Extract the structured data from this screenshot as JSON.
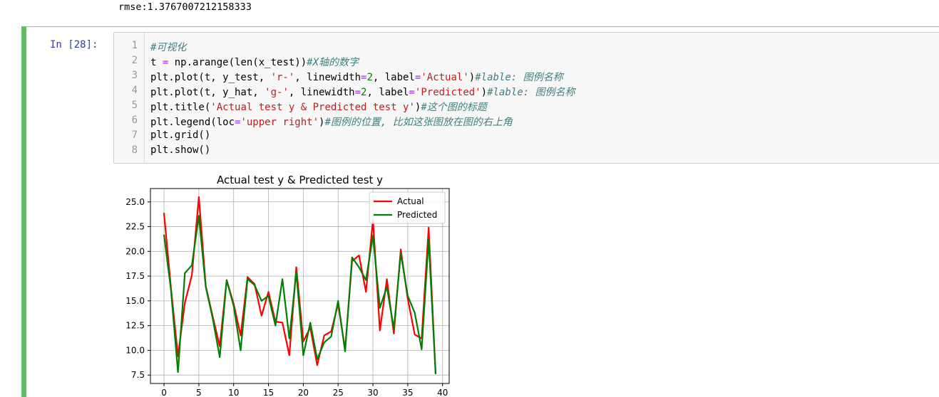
{
  "output": {
    "rmse_text": "rmse:1.3767007212158333"
  },
  "cell": {
    "prompt": "In  [28]:",
    "lines": [
      {
        "num": "1",
        "parts": [
          {
            "t": "#可视化",
            "c": "cm"
          }
        ]
      },
      {
        "num": "2",
        "parts": [
          {
            "t": "t ",
            "c": ""
          },
          {
            "t": "=",
            "c": "op"
          },
          {
            "t": " np.arange(len(x_test))",
            "c": ""
          },
          {
            "t": "#X轴的数字",
            "c": "cm"
          }
        ]
      },
      {
        "num": "3",
        "parts": [
          {
            "t": "plt.plot(t, y_test, ",
            "c": ""
          },
          {
            "t": "'r-'",
            "c": "st"
          },
          {
            "t": ", linewidth",
            "c": ""
          },
          {
            "t": "=",
            "c": "op"
          },
          {
            "t": "2",
            "c": "nu"
          },
          {
            "t": ", label",
            "c": ""
          },
          {
            "t": "=",
            "c": "op"
          },
          {
            "t": "'Actual'",
            "c": "st"
          },
          {
            "t": ")",
            "c": ""
          },
          {
            "t": "#lable: 图例名称",
            "c": "cm"
          }
        ]
      },
      {
        "num": "4",
        "parts": [
          {
            "t": "plt.plot(t, y_hat, ",
            "c": ""
          },
          {
            "t": "'g-'",
            "c": "st"
          },
          {
            "t": ", linewidth",
            "c": ""
          },
          {
            "t": "=",
            "c": "op"
          },
          {
            "t": "2",
            "c": "nu"
          },
          {
            "t": ", label",
            "c": ""
          },
          {
            "t": "=",
            "c": "op"
          },
          {
            "t": "'Predicted'",
            "c": "st"
          },
          {
            "t": ")",
            "c": ""
          },
          {
            "t": "#lable: 图例名称",
            "c": "cm"
          }
        ]
      },
      {
        "num": "5",
        "parts": [
          {
            "t": "plt.title(",
            "c": ""
          },
          {
            "t": "'Actual test y & Predicted test y'",
            "c": "st"
          },
          {
            "t": ")",
            "c": ""
          },
          {
            "t": "#这个图的标题",
            "c": "cm"
          }
        ]
      },
      {
        "num": "6",
        "parts": [
          {
            "t": "plt.legend(loc",
            "c": ""
          },
          {
            "t": "=",
            "c": "op"
          },
          {
            "t": "'upper right'",
            "c": "st"
          },
          {
            "t": ")",
            "c": ""
          },
          {
            "t": "#图例的位置, 比如这张图放在图的右上角",
            "c": "cm"
          }
        ]
      },
      {
        "num": "7",
        "parts": [
          {
            "t": "plt.grid()",
            "c": ""
          }
        ]
      },
      {
        "num": "8",
        "parts": [
          {
            "t": "plt.show()",
            "c": ""
          }
        ]
      }
    ]
  },
  "colors": {
    "actual": "#ff0000",
    "predicted": "#008000",
    "cell_bar": "#66bb6a",
    "prompt": "#303f9f"
  },
  "chart_data": {
    "type": "line",
    "title": "Actual test y & Predicted test y",
    "xlabel": "",
    "ylabel": "",
    "xlim": [
      -1.95,
      40.95
    ],
    "ylim": [
      6.65,
      26.35
    ],
    "xticks": [
      0,
      5,
      10,
      15,
      20,
      25,
      30,
      35,
      40
    ],
    "yticks": [
      7.5,
      10.0,
      12.5,
      15.0,
      17.5,
      20.0,
      22.5,
      25.0
    ],
    "xtick_labels": [
      "0",
      "5",
      "10",
      "15",
      "20",
      "25",
      "30",
      "35",
      "40"
    ],
    "ytick_labels": [
      "7.5",
      "10.0",
      "12.5",
      "15.0",
      "17.5",
      "20.0",
      "22.5",
      "25.0"
    ],
    "grid": true,
    "legend_position": "upper right",
    "x": [
      0,
      1,
      2,
      3,
      4,
      5,
      6,
      7,
      8,
      9,
      10,
      11,
      12,
      13,
      14,
      15,
      16,
      17,
      18,
      19,
      20,
      21,
      22,
      23,
      24,
      25,
      26,
      27,
      28,
      29,
      30,
      31,
      32,
      33,
      34,
      35,
      36,
      37,
      38,
      39
    ],
    "series": [
      {
        "name": "Actual",
        "color": "#ff0000",
        "values": [
          23.9,
          16.3,
          9.4,
          14.8,
          17.6,
          25.5,
          16.5,
          13.4,
          10.4,
          17.1,
          14.7,
          11.5,
          17.4,
          16.7,
          13.5,
          15.9,
          12.9,
          12.8,
          9.5,
          18.4,
          10.9,
          12.3,
          8.5,
          11.5,
          11.9,
          14.7,
          10.1,
          19.0,
          19.6,
          15.9,
          23.2,
          12.0,
          17.2,
          11.7,
          20.2,
          15.2,
          11.6,
          11.2,
          22.4,
          7.6
        ]
      },
      {
        "name": "Predicted",
        "color": "#008000",
        "values": [
          21.7,
          16.1,
          7.8,
          17.8,
          18.6,
          23.6,
          16.4,
          13.2,
          9.3,
          17.1,
          14.5,
          10.0,
          17.2,
          16.6,
          15.0,
          15.5,
          12.5,
          17.2,
          11.2,
          17.9,
          9.5,
          12.8,
          9.1,
          10.8,
          11.4,
          15.0,
          9.9,
          19.4,
          18.4,
          17.1,
          21.6,
          14.3,
          16.4,
          12.2,
          19.8,
          15.5,
          13.8,
          10.1,
          21.2,
          7.6
        ]
      }
    ]
  }
}
